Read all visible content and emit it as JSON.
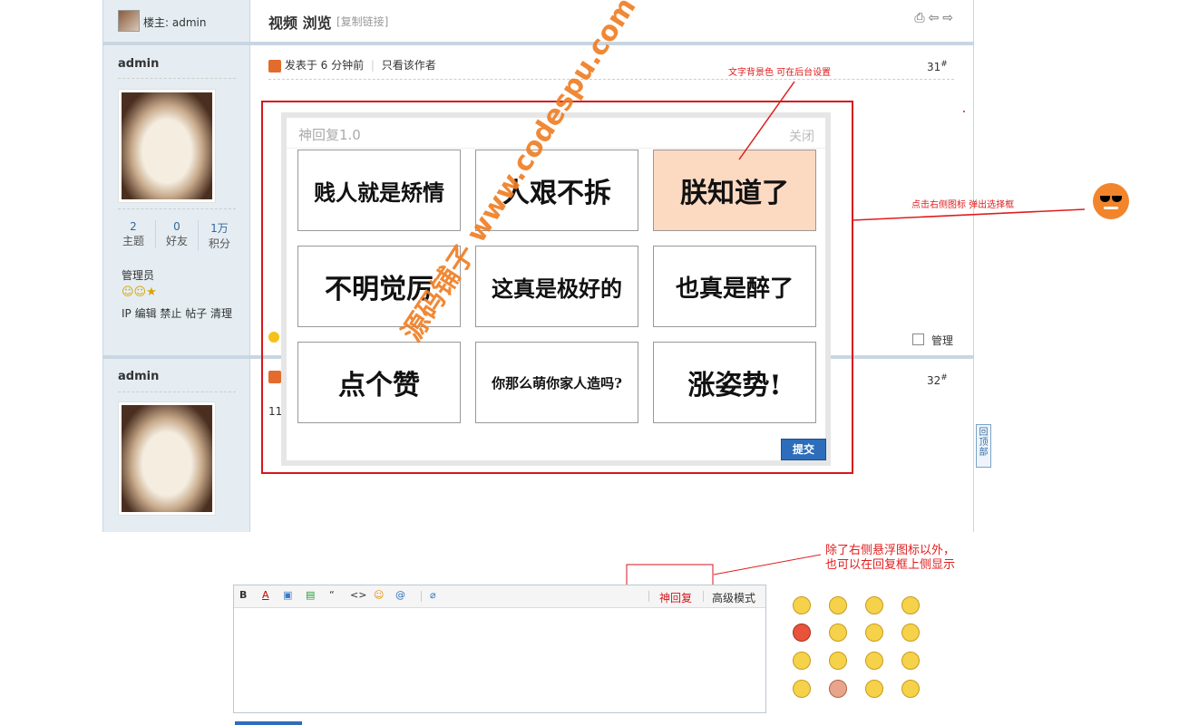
{
  "thread": {
    "owner_label": "楼主: admin",
    "title": "视频 浏览",
    "copy_link": "[复制链接]"
  },
  "posts": [
    {
      "author": "admin",
      "stats": [
        {
          "value": "2",
          "label": "主题"
        },
        {
          "value": "0",
          "label": "好友"
        },
        {
          "value": "1万",
          "label": "积分"
        }
      ],
      "group": "管理员",
      "actions": "IP 编辑 禁止 帖子 清理",
      "posted": "发表于 6 分钟前",
      "only_author": "只看该作者",
      "floor": "31",
      "manage": "管理"
    },
    {
      "author": "admin",
      "floor": "32",
      "content": "11"
    }
  ],
  "popup": {
    "title": "神回复1.0",
    "close": "关闭",
    "tiles": [
      "贱人就是矫情",
      "人艰不拆",
      "朕知道了",
      "不明觉厉",
      "这真是极好的",
      "也真是醉了",
      "点个赞",
      "你那么萌你家人造吗?",
      "涨姿势!"
    ],
    "submit": "提交"
  },
  "annotations": {
    "bg_note": "文字背景色 可在后台设置",
    "float_note": "点击右侧图标 弹出选择框",
    "editor_note_line1": "除了右侧悬浮图标以外，",
    "editor_note_line2": "也可以在回复框上侧显示"
  },
  "watermark": "源码铺子 www.codespu.com",
  "back_to_top": "回顶部",
  "editor": {
    "toolbar": [
      "B",
      "A",
      "▣",
      "▤",
      "“",
      "<>",
      "☺",
      "@",
      "⌀"
    ],
    "shen_reply": "神回复",
    "advanced": "高级模式"
  }
}
